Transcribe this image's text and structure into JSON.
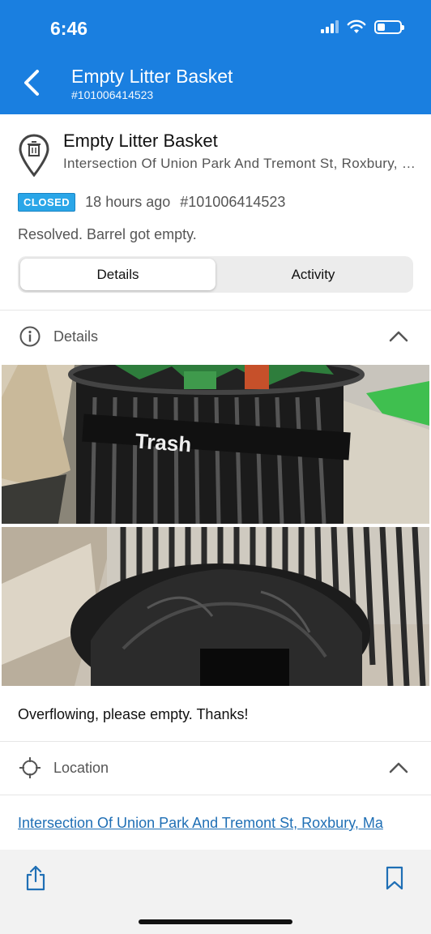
{
  "status_bar": {
    "time": "6:46"
  },
  "header": {
    "title": "Empty Litter Basket",
    "subtitle": "#101006414523",
    "accent_color": "#1a7fe0"
  },
  "summary": {
    "icon": "trash-pin-icon",
    "title": "Empty Litter Basket",
    "address": "Intersection Of Union Park And Tremont St, Roxbury, Ma",
    "status_badge": "CLOSED",
    "time_ago": "18 hours ago",
    "case_id": "#101006414523",
    "resolution": "Resolved. Barrel got empty."
  },
  "tabs": [
    {
      "label": "Details",
      "active": true
    },
    {
      "label": "Activity",
      "active": false
    }
  ],
  "details_section": {
    "icon": "info-icon",
    "label": "Details",
    "photos": [
      "overflowing trash basket",
      "empty trash basket"
    ],
    "description": "Overflowing, please empty. Thanks!"
  },
  "location_section": {
    "icon": "location-crosshair-icon",
    "label": "Location",
    "address_link": "Intersection Of Union Park And Tremont St, Roxbury, Ma"
  },
  "bottom_bar": {
    "share_icon": "share-icon",
    "bookmark_icon": "bookmark-icon"
  }
}
